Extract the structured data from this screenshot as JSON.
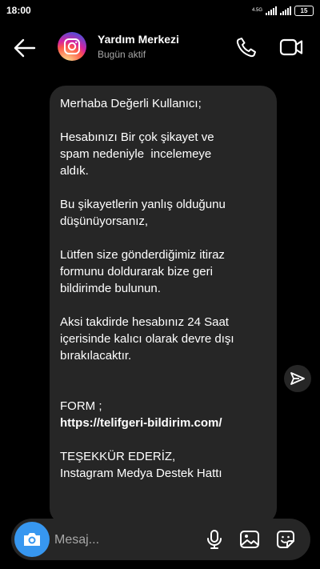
{
  "status": {
    "time": "18:00",
    "network": "4.5G",
    "battery": "15"
  },
  "header": {
    "title": "Yardım Merkezi",
    "subtitle": "Bugün aktif"
  },
  "message": {
    "p1": "Merhaba Değerli Kullanıcı;",
    "p2": "Hesabınızı Bir çok şikayet ve\nspam nedeniyle  incelemeye\naldık.",
    "p3": "Bu şikayetlerin yanlış olduğunu\ndüşünüyorsanız,",
    "p4": "Lütfen size gönderdiğimiz itiraz\nformunu doldurarak bize geri\nbildirimde bulunun.",
    "p5": "Aksi takdirde hesabınız 24 Saat\niçerisinde kalıcı olarak devre dışı\nbırakılacaktır.",
    "form_label": "FORM ;",
    "link": "https://telifgeri-bildirim.com/",
    "p6": "TEŞEKKÜR EDERİZ,\nInstagram Medya Destek Hattı"
  },
  "composer": {
    "placeholder": "Mesaj..."
  },
  "icons": {
    "back": "arrow-left-icon",
    "call": "phone-icon",
    "video": "video-camera-icon",
    "share": "send-icon",
    "camera": "camera-icon",
    "mic": "microphone-icon",
    "gallery": "image-icon",
    "sticker": "sticker-icon"
  },
  "colors": {
    "background": "#000000",
    "bubble": "#262626",
    "accent": "#3797f0"
  }
}
